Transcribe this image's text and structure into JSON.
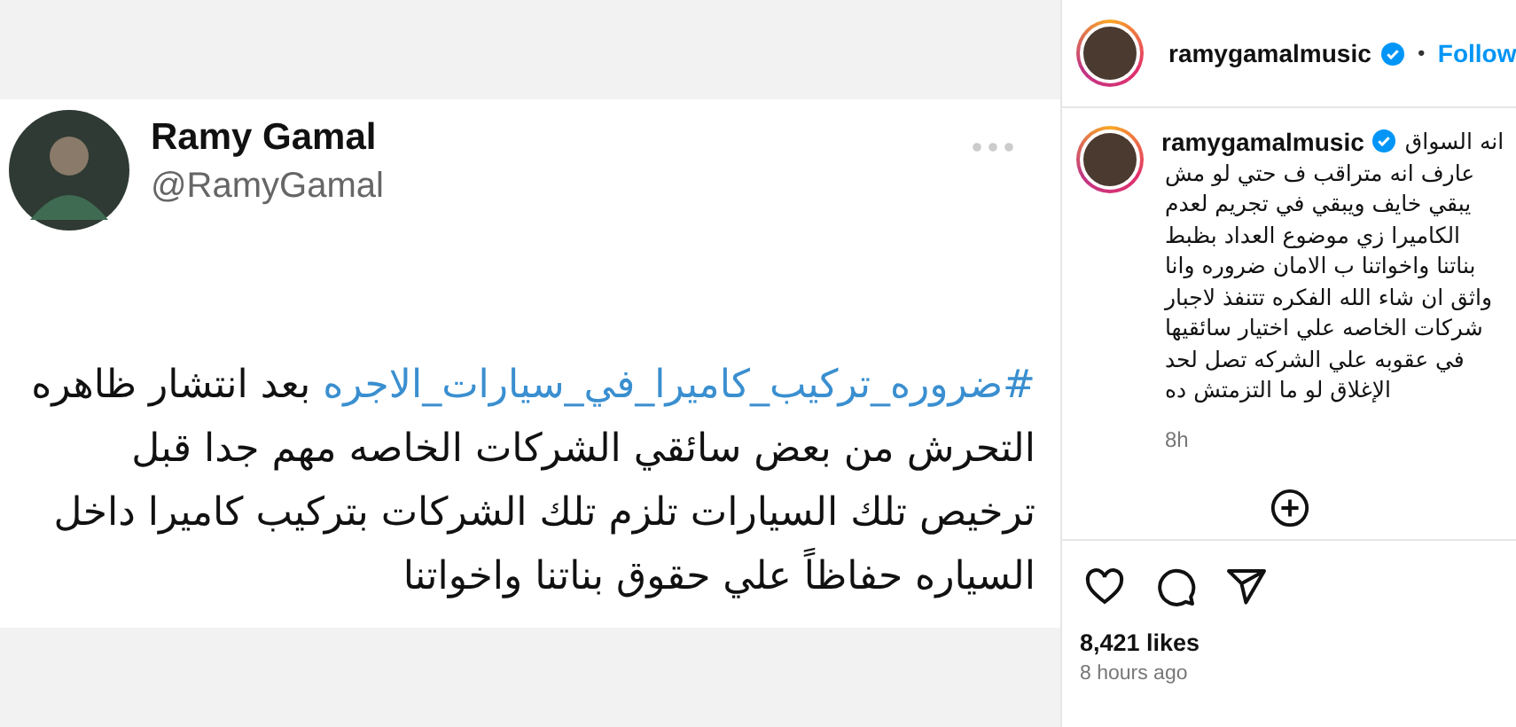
{
  "tweet": {
    "name": "Ramy Gamal",
    "handle": "@RamyGamal",
    "hashtag": "#ضروره_تركيب_كاميرا_في_سيارات_الاجره",
    "text": " بعد انتشار ظاهره التحرش من بعض سائقي الشركات الخاصه مهم جدا قبل ترخيص تلك السيارات تلزم تلك الشركات بتركيب كاميرا داخل السياره حفاظاً علي حقوق بناتنا واخواتنا"
  },
  "header": {
    "username": "ramygamalmusic",
    "verified": true,
    "separator": "•",
    "follow": "Follow"
  },
  "caption": {
    "username": "ramygamalmusic",
    "verified": true,
    "lines": [
      "انه السواق",
      "عارف انه متراقب ف حتي لو مش",
      "يبقي خايف ويبقي في تجريم لعدم",
      "الكاميرا زي موضوع العداد بظبط",
      "بناتنا واخواتنا ب الامان ضروره وانا",
      "واثق ان شاء الله الفكره تتنفذ لاجبار",
      "شركات الخاصه علي اختيار سائقيها",
      "في عقوبه علي الشركه تصل لحد",
      "الإغلاق لو ما التزمتش ده"
    ],
    "time": "8h"
  },
  "likes": "8,421 likes",
  "posted": "8 hours ago"
}
